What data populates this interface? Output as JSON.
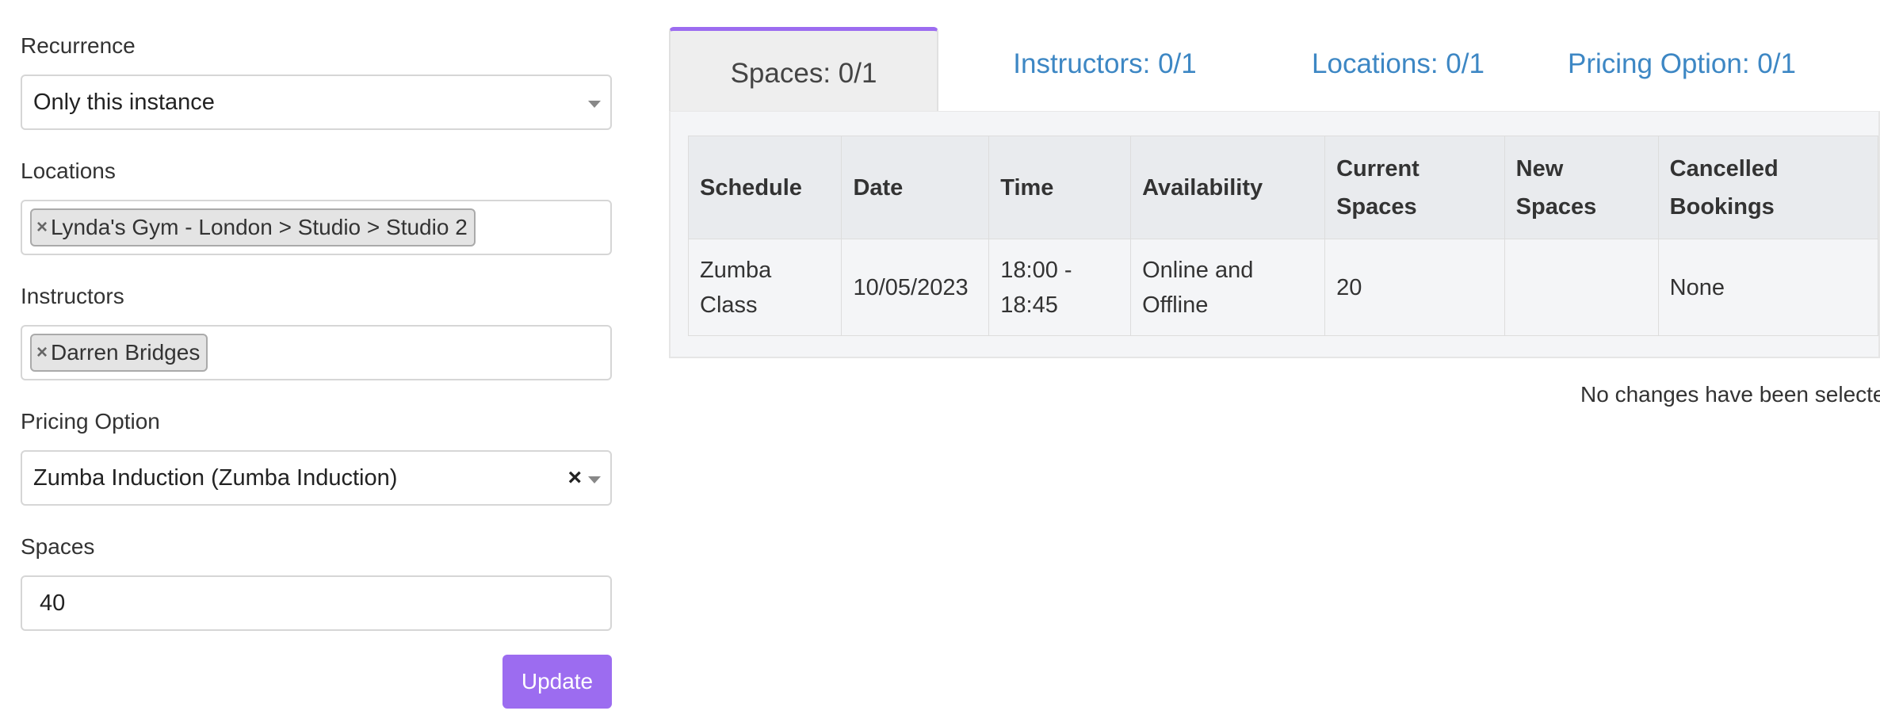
{
  "form": {
    "recurrence_label": "Recurrence",
    "recurrence_value": "Only this instance",
    "locations_label": "Locations",
    "locations_tag": "Lynda's Gym - London > Studio > Studio 2",
    "instructors_label": "Instructors",
    "instructors_tag": "Darren Bridges",
    "pricing_label": "Pricing Option",
    "pricing_value": "Zumba Induction (Zumba Induction)",
    "spaces_label": "Spaces",
    "spaces_value": "40",
    "update_label": "Update",
    "tag_remove": "×",
    "clear": "×"
  },
  "tabs": [
    {
      "label": "Spaces: 0/1",
      "active": true
    },
    {
      "label": "Instructors: 0/1",
      "active": false
    },
    {
      "label": "Locations: 0/1",
      "active": false
    },
    {
      "label": "Pricing Option: 0/1",
      "active": false
    }
  ],
  "table": {
    "headers": [
      "Schedule",
      "Date",
      "Time",
      "Availability",
      "Current Spaces",
      "New Spaces",
      "Cancelled Bookings"
    ],
    "rows": [
      [
        "Zumba Class",
        "10/05/2023",
        "18:00 - 18:45",
        "Online and Offline",
        "20",
        "",
        "None"
      ]
    ]
  },
  "status_message": "No changes have been selected"
}
